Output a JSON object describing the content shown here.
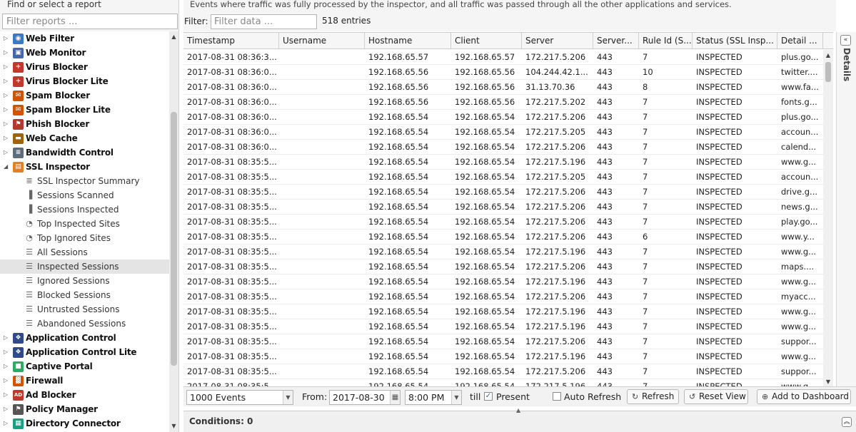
{
  "tree": {
    "header": "Find or select a report",
    "filter_placeholder": "Filter reports ...",
    "rows": [
      {
        "type": "app",
        "label": "Web Filter",
        "icon": "web-filter-icon",
        "color": "#3a79c6",
        "glyph": "◉",
        "expanded": false
      },
      {
        "type": "app",
        "label": "Web Monitor",
        "icon": "web-monitor-icon",
        "color": "#4466aa",
        "glyph": "▣",
        "expanded": false
      },
      {
        "type": "app",
        "label": "Virus Blocker",
        "icon": "virus-blocker-icon",
        "color": "#c0392b",
        "glyph": "+",
        "expanded": false
      },
      {
        "type": "app",
        "label": "Virus Blocker Lite",
        "icon": "virus-blocker-lite-icon",
        "color": "#c0392b",
        "glyph": "+",
        "expanded": false
      },
      {
        "type": "app",
        "label": "Spam Blocker",
        "icon": "spam-blocker-icon",
        "color": "#d35400",
        "glyph": "✉",
        "expanded": false
      },
      {
        "type": "app",
        "label": "Spam Blocker Lite",
        "icon": "spam-blocker-lite-icon",
        "color": "#d35400",
        "glyph": "✉",
        "expanded": false
      },
      {
        "type": "app",
        "label": "Phish Blocker",
        "icon": "phish-blocker-icon",
        "color": "#b03a2e",
        "glyph": "⚑",
        "expanded": false
      },
      {
        "type": "app",
        "label": "Web Cache",
        "icon": "web-cache-icon",
        "color": "#a0650a",
        "glyph": "▬",
        "expanded": false
      },
      {
        "type": "app",
        "label": "Bandwidth Control",
        "icon": "bandwidth-control-icon",
        "color": "#5d6d7e",
        "glyph": "≡",
        "expanded": false
      },
      {
        "type": "app",
        "label": "SSL Inspector",
        "icon": "ssl-inspector-icon",
        "color": "#e67e22",
        "glyph": "▤",
        "expanded": true
      },
      {
        "type": "sub",
        "label": "SSL Inspector Summary",
        "icon": "summary-text-icon",
        "glyph": "≣"
      },
      {
        "type": "sub",
        "label": "Sessions Scanned",
        "icon": "bar-chart-icon",
        "glyph": "▐"
      },
      {
        "type": "sub",
        "label": "Sessions Inspected",
        "icon": "bar-chart-icon",
        "glyph": "▐"
      },
      {
        "type": "sub",
        "label": "Top Inspected Sites",
        "icon": "pie-chart-icon",
        "glyph": "◔"
      },
      {
        "type": "sub",
        "label": "Top Ignored Sites",
        "icon": "pie-chart-icon",
        "glyph": "◔"
      },
      {
        "type": "sub",
        "label": "All Sessions",
        "icon": "list-icon",
        "glyph": "☰"
      },
      {
        "type": "sub",
        "label": "Inspected Sessions",
        "icon": "list-icon",
        "glyph": "☰",
        "selected": true
      },
      {
        "type": "sub",
        "label": "Ignored Sessions",
        "icon": "list-icon",
        "glyph": "☰"
      },
      {
        "type": "sub",
        "label": "Blocked Sessions",
        "icon": "list-icon",
        "glyph": "☰"
      },
      {
        "type": "sub",
        "label": "Untrusted Sessions",
        "icon": "list-icon",
        "glyph": "☰"
      },
      {
        "type": "sub",
        "label": "Abandoned Sessions",
        "icon": "list-icon",
        "glyph": "☰"
      },
      {
        "type": "app",
        "label": "Application Control",
        "icon": "application-control-icon",
        "color": "#2e4a8a",
        "glyph": "❖",
        "expanded": false
      },
      {
        "type": "app",
        "label": "Application Control Lite",
        "icon": "application-control-lite-icon",
        "color": "#2e4a8a",
        "glyph": "❖",
        "expanded": false
      },
      {
        "type": "app",
        "label": "Captive Portal",
        "icon": "captive-portal-icon",
        "color": "#27ae60",
        "glyph": "■",
        "expanded": false
      },
      {
        "type": "app",
        "label": "Firewall",
        "icon": "firewall-icon",
        "color": "#d35400",
        "glyph": "▓",
        "expanded": false
      },
      {
        "type": "app",
        "label": "Ad Blocker",
        "icon": "ad-blocker-icon",
        "color": "#c0392b",
        "glyph": "AD",
        "expanded": false
      },
      {
        "type": "app",
        "label": "Policy Manager",
        "icon": "policy-manager-icon",
        "color": "#555555",
        "glyph": "⚑",
        "expanded": false
      },
      {
        "type": "app",
        "label": "Directory Connector",
        "icon": "directory-connector-icon",
        "color": "#16a085",
        "glyph": "▦",
        "expanded": false
      }
    ]
  },
  "report": {
    "description": "Events where traffic was fully processed by the inspector, and all traffic was passed through all the other applications and services.",
    "filter_label": "Filter:",
    "filter_placeholder": "Filter data ...",
    "entries": "518 entries"
  },
  "grid": {
    "columns": [
      "Timestamp",
      "Username",
      "Hostname",
      "Client",
      "Server",
      "Server...",
      "Rule Id (S...",
      "Status (SSL Insp...",
      "Detail ..."
    ],
    "rows": [
      [
        "2017-08-31 08:36:3...",
        "",
        "192.168.65.57",
        "192.168.65.57",
        "172.217.5.206",
        "443",
        "7",
        "INSPECTED",
        "plus.go..."
      ],
      [
        "2017-08-31 08:36:0...",
        "",
        "192.168.65.56",
        "192.168.65.56",
        "104.244.42.1...",
        "443",
        "10",
        "INSPECTED",
        "twitter...."
      ],
      [
        "2017-08-31 08:36:0...",
        "",
        "192.168.65.56",
        "192.168.65.56",
        "31.13.70.36",
        "443",
        "8",
        "INSPECTED",
        "www.fa..."
      ],
      [
        "2017-08-31 08:36:0...",
        "",
        "192.168.65.56",
        "192.168.65.56",
        "172.217.5.202",
        "443",
        "7",
        "INSPECTED",
        "fonts.g..."
      ],
      [
        "2017-08-31 08:36:0...",
        "",
        "192.168.65.54",
        "192.168.65.54",
        "172.217.5.206",
        "443",
        "7",
        "INSPECTED",
        "plus.go..."
      ],
      [
        "2017-08-31 08:36:0...",
        "",
        "192.168.65.54",
        "192.168.65.54",
        "172.217.5.205",
        "443",
        "7",
        "INSPECTED",
        "accoun..."
      ],
      [
        "2017-08-31 08:36:0...",
        "",
        "192.168.65.54",
        "192.168.65.54",
        "172.217.5.206",
        "443",
        "7",
        "INSPECTED",
        "calend..."
      ],
      [
        "2017-08-31 08:35:5...",
        "",
        "192.168.65.54",
        "192.168.65.54",
        "172.217.5.196",
        "443",
        "7",
        "INSPECTED",
        "www.g..."
      ],
      [
        "2017-08-31 08:35:5...",
        "",
        "192.168.65.54",
        "192.168.65.54",
        "172.217.5.205",
        "443",
        "7",
        "INSPECTED",
        "accoun..."
      ],
      [
        "2017-08-31 08:35:5...",
        "",
        "192.168.65.54",
        "192.168.65.54",
        "172.217.5.206",
        "443",
        "7",
        "INSPECTED",
        "drive.g..."
      ],
      [
        "2017-08-31 08:35:5...",
        "",
        "192.168.65.54",
        "192.168.65.54",
        "172.217.5.206",
        "443",
        "7",
        "INSPECTED",
        "news.g..."
      ],
      [
        "2017-08-31 08:35:5...",
        "",
        "192.168.65.54",
        "192.168.65.54",
        "172.217.5.206",
        "443",
        "7",
        "INSPECTED",
        "play.go..."
      ],
      [
        "2017-08-31 08:35:5...",
        "",
        "192.168.65.54",
        "192.168.65.54",
        "172.217.5.206",
        "443",
        "6",
        "INSPECTED",
        "www.y..."
      ],
      [
        "2017-08-31 08:35:5...",
        "",
        "192.168.65.54",
        "192.168.65.54",
        "172.217.5.196",
        "443",
        "7",
        "INSPECTED",
        "www.g..."
      ],
      [
        "2017-08-31 08:35:5...",
        "",
        "192.168.65.54",
        "192.168.65.54",
        "172.217.5.206",
        "443",
        "7",
        "INSPECTED",
        "maps...."
      ],
      [
        "2017-08-31 08:35:5...",
        "",
        "192.168.65.54",
        "192.168.65.54",
        "172.217.5.196",
        "443",
        "7",
        "INSPECTED",
        "www.g..."
      ],
      [
        "2017-08-31 08:35:5...",
        "",
        "192.168.65.54",
        "192.168.65.54",
        "172.217.5.206",
        "443",
        "7",
        "INSPECTED",
        "myacc..."
      ],
      [
        "2017-08-31 08:35:5...",
        "",
        "192.168.65.54",
        "192.168.65.54",
        "172.217.5.196",
        "443",
        "7",
        "INSPECTED",
        "www.g..."
      ],
      [
        "2017-08-31 08:35:5...",
        "",
        "192.168.65.54",
        "192.168.65.54",
        "172.217.5.196",
        "443",
        "7",
        "INSPECTED",
        "www.g..."
      ],
      [
        "2017-08-31 08:35:5...",
        "",
        "192.168.65.54",
        "192.168.65.54",
        "172.217.5.206",
        "443",
        "7",
        "INSPECTED",
        "suppor..."
      ],
      [
        "2017-08-31 08:35:5...",
        "",
        "192.168.65.54",
        "192.168.65.54",
        "172.217.5.196",
        "443",
        "7",
        "INSPECTED",
        "www.g..."
      ],
      [
        "2017-08-31 08:35:5...",
        "",
        "192.168.65.54",
        "192.168.65.54",
        "172.217.5.206",
        "443",
        "7",
        "INSPECTED",
        "suppor..."
      ],
      [
        "2017-08-31 08:35:5...",
        "",
        "192.168.65.54",
        "192.168.65.54",
        "172.217.5.196",
        "443",
        "7",
        "INSPECTED",
        "www.g..."
      ]
    ]
  },
  "details": {
    "label": "Details"
  },
  "toolbar": {
    "events_limit": "1000 Events",
    "from_label": "From:",
    "from_date": "2017-08-30",
    "from_time": "8:00 PM",
    "till_label": "till",
    "present_label": "Present",
    "present_checked": true,
    "auto_refresh_label": "Auto Refresh",
    "auto_refresh_checked": false,
    "refresh_label": "Refresh",
    "reset_view_label": "Reset View",
    "add_dashboard_label": "Add to Dashboard"
  },
  "conditions": {
    "label": "Conditions: 0"
  }
}
